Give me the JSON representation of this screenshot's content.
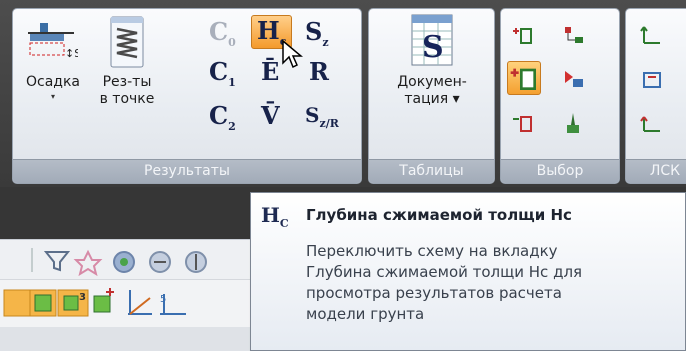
{
  "ribbon": {
    "groups": [
      {
        "caption": "Результаты"
      },
      {
        "caption": "Таблицы"
      },
      {
        "caption": "Выбор"
      },
      {
        "caption": "ЛСК"
      }
    ],
    "osadka": {
      "line1": "Осадка",
      "arrow": "▾"
    },
    "rezty": {
      "line1": "Рез-ты",
      "line2": "в точке"
    },
    "docs": {
      "line1": "Докумен-",
      "line2": "тация ▾"
    },
    "mini_buttons": {
      "c0": "C",
      "c0_sub": "0",
      "c1": "C",
      "c1_sub": "1",
      "c2": "C",
      "c2_sub": "2",
      "hc": "H",
      "hc_sub": "c",
      "e": "Ē",
      "v": "V̄",
      "sz": "S",
      "sz_sub": "z",
      "r": "R",
      "szr": "S",
      "szr_sub": "z/R"
    }
  },
  "tooltip": {
    "icon": "H",
    "icon_sub": "C",
    "title": "Глубина сжимаемой толщи Нс",
    "lines": [
      "Переключить схему на вкладку",
      "Глубина сжимаемой толщи Нс для",
      "просмотра результатов расчета",
      "модели грунта"
    ]
  },
  "colors": {
    "accent_orange": "#f49a2c",
    "ribbon_bg": "#e9edf2",
    "caption_bg": "#a2abb8"
  }
}
